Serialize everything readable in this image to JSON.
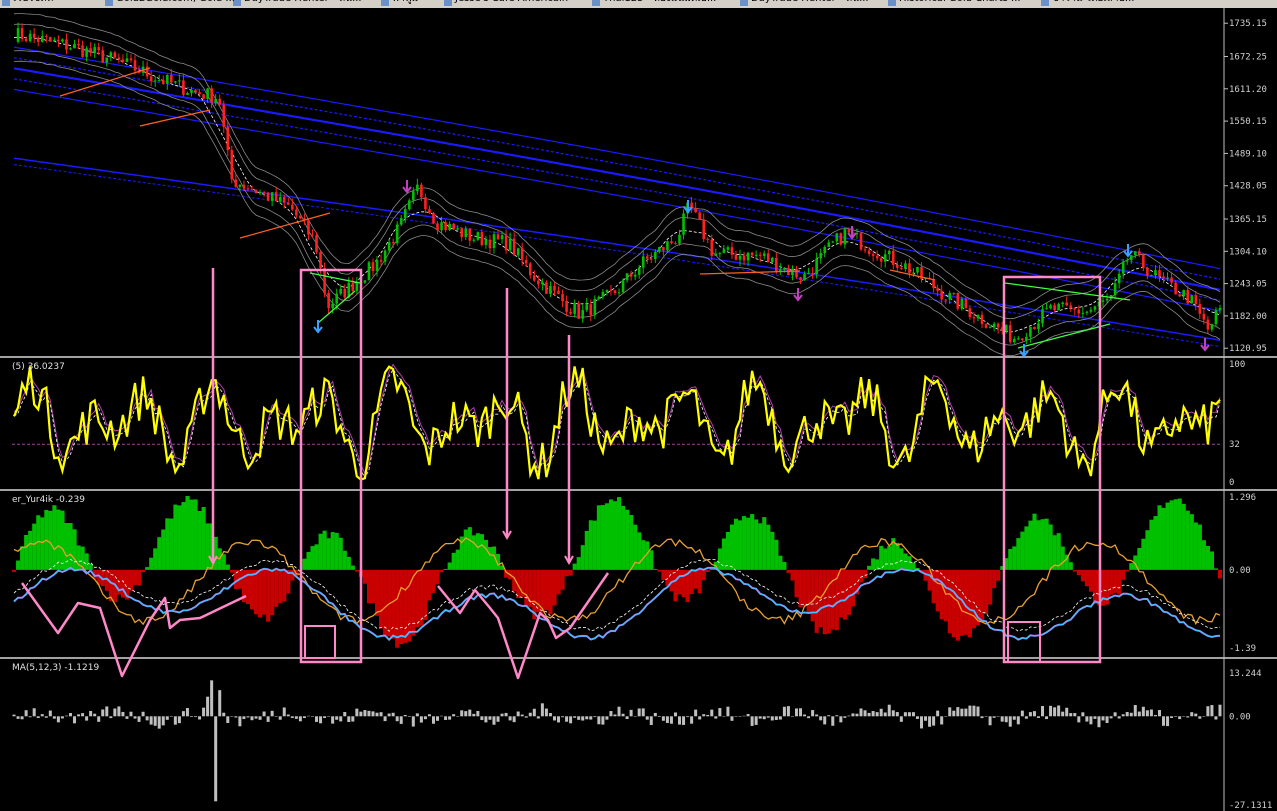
{
  "browser_tabs": [
    {
      "label": "เว็บไซต์ที่",
      "icon": "page-icon"
    },
    {
      "label": "Gold2Gold.com, Gold ...",
      "icon": "page-icon"
    },
    {
      "label": "DayTrade Hunter - หน...",
      "icon": "globe-icon"
    },
    {
      "label": "ฟ้าฟูม",
      "icon": "picture-icon"
    },
    {
      "label": "Jesse's Cafe Americain",
      "icon": "cafe-icon"
    },
    {
      "label": "Thai125 - ห้องมั่นมัดเอ...",
      "icon": "chart-icon"
    },
    {
      "label": "DayTrade Hunter - หน...",
      "icon": "globe-icon"
    },
    {
      "label": "Historical Gold Charts ...",
      "icon": "hand-icon"
    },
    {
      "label": "ข้าว้าน โดยเสาบ...",
      "icon": "page-icon"
    }
  ],
  "panels": {
    "price": {
      "axis_labels": [
        "1735.15",
        "1672.25",
        "1611.20",
        "1550.15",
        "1489.10",
        "1428.05",
        "1365.15",
        "1304.10",
        "1243.05",
        "1182.00",
        "1120.95"
      ],
      "ylim": [
        1110,
        1745
      ]
    },
    "stoch": {
      "title": "(5) 36.0237",
      "axis_labels": [
        "100",
        "32",
        "0"
      ]
    },
    "osc": {
      "title": "er_Yur4ik -0.239",
      "axis_labels": [
        "1.296",
        "0.00",
        "-1.39"
      ]
    },
    "macd": {
      "title": "MA(5,12,3) -1.1219",
      "axis_labels": [
        "13.244",
        "0.00",
        "-27.1311"
      ]
    }
  },
  "colors": {
    "background": "#000000",
    "bull_candle": "#00c000",
    "bear_candle": "#ff2020",
    "bands_blue": "#1a1aff",
    "stoch_line": "#ffff00",
    "hist_pos": "#00c000",
    "hist_neg": "#c80000",
    "osc_orange": "#e8a030",
    "osc_cyan": "#40c0ff",
    "annotation_pink": "#ff88c8",
    "macd_hist": "#c0c0c0"
  },
  "annotations": {
    "boxes": 2,
    "vertical_markers": 4
  }
}
